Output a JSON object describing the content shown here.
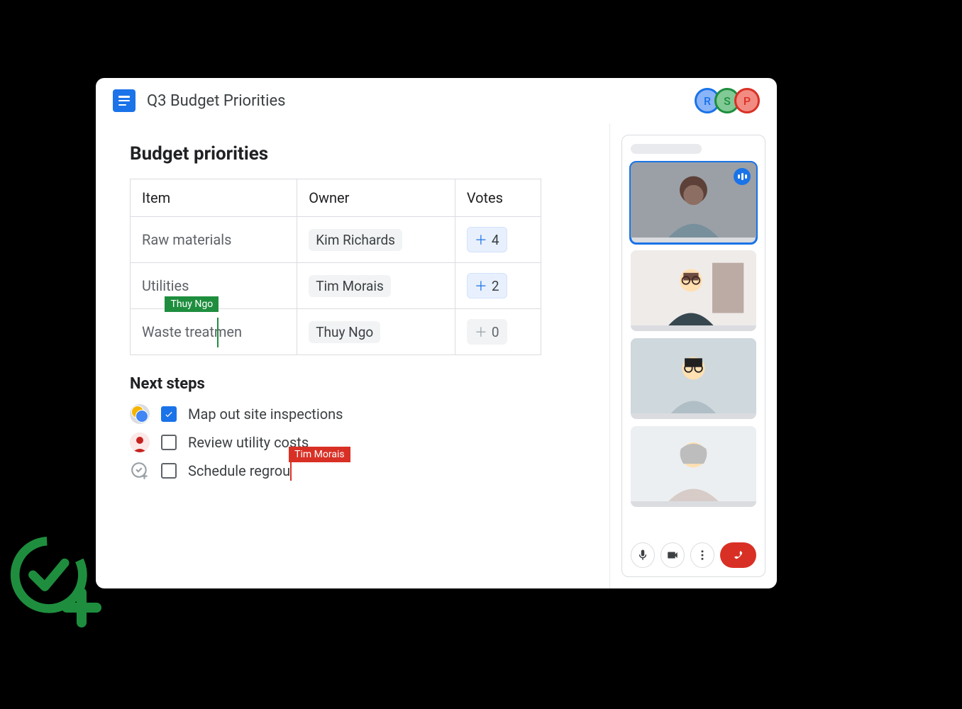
{
  "header": {
    "title": "Q3 Budget Priorities",
    "collaborators": [
      {
        "initial": "R",
        "color": "blue"
      },
      {
        "initial": "S",
        "color": "green"
      },
      {
        "initial": "P",
        "color": "red"
      }
    ]
  },
  "doc": {
    "section_title": "Budget priorities",
    "table": {
      "headers": {
        "item": "Item",
        "owner": "Owner",
        "votes": "Votes"
      },
      "rows": [
        {
          "item": "Raw materials",
          "owner": "Kim Richards",
          "votes": "4",
          "vote_active": true
        },
        {
          "item": "Utilities",
          "owner": "Tim Morais",
          "votes": "2",
          "vote_active": true
        },
        {
          "item": "Waste treatmen",
          "owner": "Thuy Ngo",
          "votes": "0",
          "vote_active": false,
          "cursor_user": "Thuy Ngo"
        }
      ]
    },
    "next_steps_title": "Next steps",
    "tasks": [
      {
        "text": "Map out site inspections",
        "checked": true,
        "assignee_type": "multi"
      },
      {
        "text": "Review utility costs",
        "checked": false,
        "assignee_type": "single"
      },
      {
        "text": "Schedule regrou",
        "checked": false,
        "assignee_type": "add",
        "cursor_user": "Tim Morais"
      }
    ]
  },
  "meet": {
    "controls": {
      "mic": "mic",
      "camera": "camera",
      "more": "more",
      "hangup": "hangup"
    }
  }
}
